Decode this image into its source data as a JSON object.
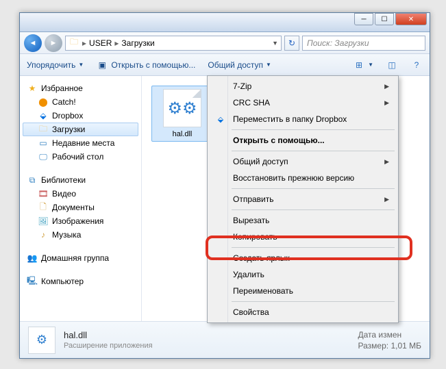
{
  "breadcrumb": {
    "item1": "USER",
    "item2": "Загрузки"
  },
  "search": {
    "placeholder": "Поиск: Загрузки"
  },
  "toolbar": {
    "organize": "Упорядочить",
    "open_with": "Открыть с помощью...",
    "share": "Общий доступ"
  },
  "sidebar": {
    "favorites": "Избранное",
    "fav_items": {
      "catch": "Catch!",
      "dropbox": "Dropbox",
      "downloads": "Загрузки",
      "recent": "Недавние места",
      "desktop": "Рабочий стол"
    },
    "libraries": "Библиотеки",
    "lib_items": {
      "video": "Видео",
      "docs": "Документы",
      "images": "Изображения",
      "music": "Музыка"
    },
    "homegroup": "Домашняя группа",
    "computer": "Компьютер"
  },
  "file": {
    "name": "hal.dll"
  },
  "context": {
    "zip": "7-Zip",
    "crc": "CRC SHA",
    "move_dropbox": "Переместить в папку Dropbox",
    "open_with": "Открыть с помощью...",
    "share": "Общий доступ",
    "restore": "Восстановить прежнюю версию",
    "send_to": "Отправить",
    "cut": "Вырезать",
    "copy": "Копировать",
    "shortcut": "Создать ярлык",
    "delete": "Удалить",
    "rename": "Переименовать",
    "properties": "Свойства"
  },
  "status": {
    "name": "hal.dll",
    "type": "Расширение приложения",
    "date_label": "Дата измен",
    "size_label": "Размер:",
    "size_value": "1,01 МБ"
  }
}
